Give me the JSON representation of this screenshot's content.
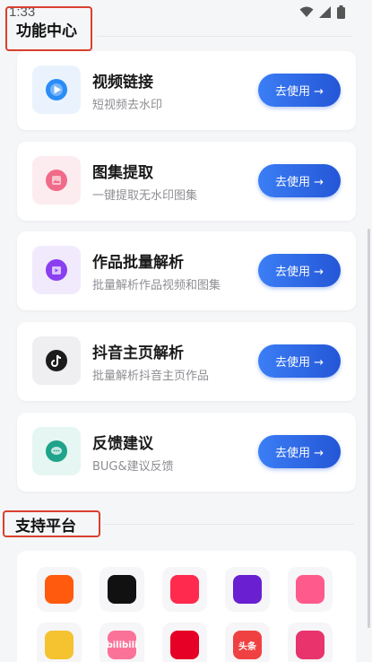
{
  "status": {
    "time": "1:33"
  },
  "header": {
    "title": "功能中心"
  },
  "features": [
    {
      "title": "视频链接",
      "subtitle": "短视频去水印",
      "button": "去使用 →",
      "icon": "video-play-icon",
      "color": "#2b8cf7",
      "bg": "#eaf3fd"
    },
    {
      "title": "图集提取",
      "subtitle": "一键提取无水印图集",
      "button": "去使用 →",
      "icon": "image-gallery-icon",
      "color": "#f06b8a",
      "bg": "#fdecef"
    },
    {
      "title": "作品批量解析",
      "subtitle": "批量解析作品视频和图集",
      "button": "去使用 →",
      "icon": "batch-parse-icon",
      "color": "#8a3ff0",
      "bg": "#f1eafd"
    },
    {
      "title": "抖音主页解析",
      "subtitle": "批量解析抖音主页作品",
      "button": "去使用 →",
      "icon": "douyin-icon",
      "color": "#1c1c1c",
      "bg": "#efeff1"
    },
    {
      "title": "反馈建议",
      "subtitle": "BUG&建议反馈",
      "button": "去使用 →",
      "icon": "feedback-chat-icon",
      "color": "#1fa38a",
      "bg": "#e6f6f2"
    }
  ],
  "platforms_section": {
    "title": "支持平台"
  },
  "platforms": [
    {
      "name": "kuaishou-icon",
      "color": "#ff5a0e",
      "glyph": ""
    },
    {
      "name": "tiktok-icon",
      "color": "#111111",
      "glyph": ""
    },
    {
      "name": "weishi-icon",
      "color": "#ff2a4d",
      "glyph": ""
    },
    {
      "name": "video-platform-icon",
      "color": "#6a1fd1",
      "glyph": ""
    },
    {
      "name": "pipixia-icon",
      "color": "#ff5a8c",
      "glyph": ""
    },
    {
      "name": "zuiyou-icon",
      "color": "#f5c230",
      "glyph": ""
    },
    {
      "name": "bilibili-icon",
      "color": "#fb7299",
      "glyph": "bilibili"
    },
    {
      "name": "netease-music-icon",
      "color": "#e60026",
      "glyph": ""
    },
    {
      "name": "toutiao-icon",
      "color": "#f04142",
      "glyph": "头条"
    },
    {
      "name": "lvzhou-icon",
      "color": "#e8336d",
      "glyph": ""
    }
  ]
}
